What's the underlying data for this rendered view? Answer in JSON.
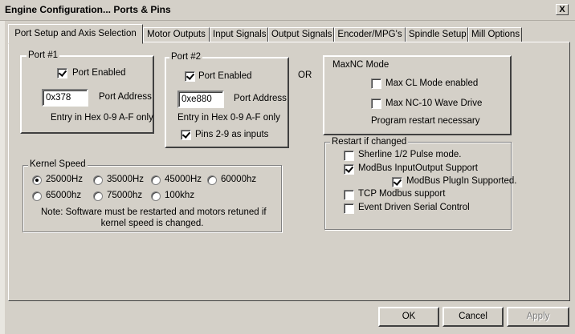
{
  "window": {
    "title": "Engine Configuration... Ports & Pins",
    "close": "X"
  },
  "tabs": [
    {
      "label": "Port Setup and Axis Selection",
      "active": true
    },
    {
      "label": "Motor Outputs"
    },
    {
      "label": "Input Signals"
    },
    {
      "label": "Output Signals"
    },
    {
      "label": "Encoder/MPG's"
    },
    {
      "label": "Spindle Setup"
    },
    {
      "label": "Mill Options"
    }
  ],
  "port1": {
    "title": "Port #1",
    "enabled_label": "Port Enabled",
    "enabled": true,
    "address": "0x378",
    "address_label": "Port Address",
    "hint": "Entry in Hex 0-9 A-F only"
  },
  "port2": {
    "title": "Port #2",
    "enabled_label": "Port Enabled",
    "enabled": true,
    "address": "0xe880",
    "address_label": "Port Address",
    "hint": "Entry in Hex 0-9 A-F only",
    "pins_label": "Pins 2-9 as inputs",
    "pins_inputs": true
  },
  "or_label": "OR",
  "maxnc": {
    "title": "MaxNC Mode",
    "cl_label": "Max CL Mode enabled",
    "cl": false,
    "nc10_label": "Max NC-10 Wave Drive",
    "nc10": false,
    "note": "Program restart necessary"
  },
  "kernel": {
    "title": "Kernel Speed",
    "options": [
      "25000Hz",
      "35000Hz",
      "45000Hz",
      "60000hz",
      "65000hz",
      "75000hz",
      "100khz"
    ],
    "selected": "25000Hz",
    "note_line1": "Note: Software must be restarted and motors retuned if",
    "note_line2": "kernel speed is changed."
  },
  "restart": {
    "title": "Restart if changed",
    "sherline_label": "Sherline 1/2 Pulse mode.",
    "sherline": false,
    "modbus_label": "ModBus InputOutput Support",
    "modbus": true,
    "plugin_label": "ModBus PlugIn Supported.",
    "plugin": true,
    "tcp_label": "TCP Modbus support",
    "tcp": false,
    "serial_label": "Event Driven Serial Control",
    "serial": false
  },
  "buttons": {
    "ok": "OK",
    "cancel": "Cancel",
    "apply": "Apply"
  }
}
